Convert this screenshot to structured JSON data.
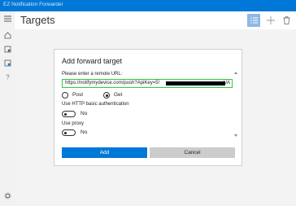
{
  "window": {
    "title": "EZ Notification Forwarder"
  },
  "nav": {
    "items": [
      {
        "name": "hamburger-icon"
      },
      {
        "name": "home-icon"
      },
      {
        "name": "filter-icon"
      },
      {
        "name": "targets-icon"
      },
      {
        "name": "help-icon"
      }
    ],
    "settings_icon": "gear-icon"
  },
  "page": {
    "title": "Targets"
  },
  "commands": [
    {
      "name": "list-icon",
      "active": true
    },
    {
      "name": "add-icon",
      "active": false
    },
    {
      "name": "delete-icon",
      "active": false
    }
  ],
  "dialog": {
    "title": "Add forward target",
    "url_label": "Please enter a remote URL:",
    "url_value": "https://notifymydevice.com/push?ApiKey=5!",
    "url_tail": "UA",
    "method_post_label": "Post",
    "method_get_label": "Get",
    "method_selected": "Get",
    "http_auth_label": "Use HTTP basic authentication",
    "http_auth_state": "No",
    "proxy_label": "Use proxy",
    "proxy_state": "No",
    "add_button": "Add",
    "cancel_button": "Cancel"
  },
  "colors": {
    "accent": "#0078d7",
    "input_border": "#2ecc40",
    "active_command": "#8fb8e6"
  }
}
